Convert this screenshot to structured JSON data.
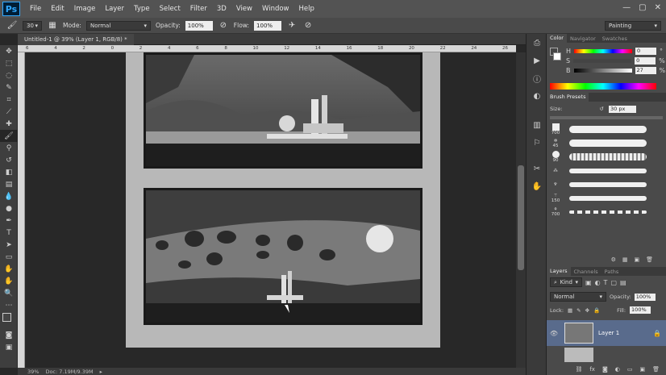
{
  "app": {
    "logo": "Ps"
  },
  "menu": [
    "File",
    "Edit",
    "Image",
    "Layer",
    "Type",
    "Select",
    "Filter",
    "3D",
    "View",
    "Window",
    "Help"
  ],
  "window_controls": [
    "—",
    "▢",
    "✕"
  ],
  "options": {
    "brush_size": "30",
    "mode_label": "Mode:",
    "mode_value": "Normal",
    "opacity_label": "Opacity:",
    "opacity_value": "100%",
    "flow_label": "Flow:",
    "flow_value": "100%",
    "workspace": "Painting"
  },
  "document": {
    "tab_title": "Untitled-1 @ 39% (Layer 1, RGB/8) *"
  },
  "ruler_ticks": [
    "6",
    "4",
    "2",
    "0",
    "2",
    "4",
    "6",
    "8",
    "10",
    "12",
    "14",
    "16",
    "18",
    "20",
    "22",
    "24",
    "26"
  ],
  "status": {
    "zoom": "39%",
    "doc": "Doc: 7.19M/9.39M"
  },
  "color_panel": {
    "tabs": [
      "Color",
      "Navigator",
      "Swatches"
    ],
    "h_label": "H",
    "h_value": "0",
    "h_unit": "°",
    "s_label": "S",
    "s_value": "0",
    "s_unit": "%",
    "b_label": "B",
    "b_value": "27",
    "b_unit": "%"
  },
  "brush_presets": {
    "title": "Brush Presets",
    "size_label": "Size:",
    "size_value": "30 px",
    "thumbs": [
      "700",
      "45",
      "90",
      "",
      "",
      "150",
      "700"
    ]
  },
  "layers": {
    "tabs": [
      "Layers",
      "Channels",
      "Paths"
    ],
    "kind": "Kind",
    "blend": "Normal",
    "opacity_label": "Opacity:",
    "opacity_value": "100%",
    "lock_label": "Lock:",
    "fill_label": "Fill:",
    "fill_value": "100%",
    "layer_name": "Layer 1"
  },
  "colors": {
    "accent_layer": "#596b8c",
    "foreground": "#454545",
    "background": "#ffffff"
  }
}
